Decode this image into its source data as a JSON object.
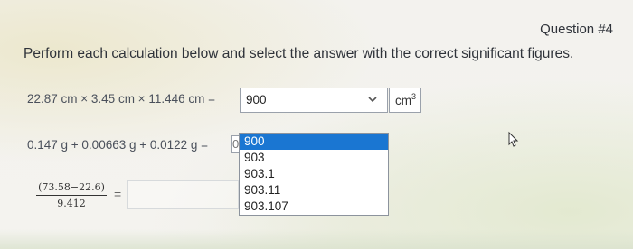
{
  "question": {
    "number": "Question #4",
    "instructions": "Perform each calculation below and select the answer with the correct significant figures."
  },
  "rows": [
    {
      "expression": "22.87 cm × 3.45 cm × 11.446 cm =",
      "selected_value": "900",
      "unit": "cm",
      "unit_exponent": "3"
    },
    {
      "expression": "0.147 g + 0.00663 g + 0.0122 g =",
      "partial_value": "0"
    },
    {
      "numerator": "(73.58−22.6)",
      "denominator": "9.412",
      "equals": "="
    }
  ],
  "dropdown": {
    "options": [
      "900",
      "903",
      "903.1",
      "903.11",
      "903.107"
    ],
    "selected_index": 0
  },
  "icons": {
    "select_arrow": "chevron-down-icon",
    "mouse_pointer": "cursor-icon"
  },
  "colors": {
    "selected_option_bg": "#1a76d2",
    "border": "#9aa1ab"
  }
}
